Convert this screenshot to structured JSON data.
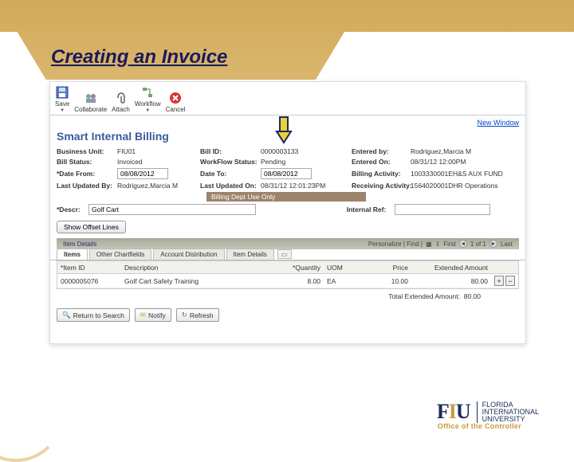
{
  "slide_title": "Creating an Invoice",
  "toolbar": {
    "save": "Save",
    "collaborate": "Collaborate",
    "attach": "Attach",
    "workflow": "Workflow",
    "cancel": "Cancel"
  },
  "links": {
    "new_window": "New Window"
  },
  "page_heading": "Smart Internal Billing",
  "form": {
    "business_unit": {
      "label": "Business Unit:",
      "value": "FIU01"
    },
    "bill_id": {
      "label": "Bill ID:",
      "value": "0000003133"
    },
    "entered_by": {
      "label": "Entered by:",
      "value": "Rodriguez,Marcia M"
    },
    "bill_status": {
      "label": "Bill Status:",
      "value": "Invoiced"
    },
    "workflow_status": {
      "label": "WorkFlow Status:",
      "value": "Pending"
    },
    "entered_on": {
      "label": "Entered On:",
      "value": "08/31/12 12:00PM"
    },
    "date_from": {
      "label": "*Date From:",
      "value": "08/08/2012"
    },
    "date_to": {
      "label": "Date To:",
      "value": "08/08/2012"
    },
    "billing_activity": {
      "label": "Billing Activity:",
      "value": "1003330001EH&S AUX FUND"
    },
    "last_updated_by": {
      "label": "Last Updated By:",
      "value": "Rodriguez,Marcia M"
    },
    "last_updated_on": {
      "label": "Last Updated On:",
      "value": "08/31/12 12:01:23PM"
    },
    "receiving_activity": {
      "label": "Receiving Activity:",
      "value": "1564020001DHR Operations"
    },
    "descr": {
      "label": "*Descr:",
      "value": "Golf Cart"
    },
    "internal_ref": {
      "label": "Internal Ref:",
      "value": ""
    }
  },
  "billing_dept_bar": "Billing Dept Use Only",
  "show_offset": "Show Offset Lines",
  "item_details_title": "Item Details",
  "tabs": {
    "items": "Items",
    "other": "Other Chartfields",
    "account": "Account Distribution",
    "details": "Item Details"
  },
  "grid_toolbar": {
    "personalize": "Personalize | Find |",
    "pager": "First",
    "count": "1 of 1",
    "last": "Last"
  },
  "grid": {
    "headers": {
      "item_id": "*Item ID",
      "description": "Description",
      "quantity": "*Quantity",
      "uom": "UOM",
      "price": "Price",
      "extended": "Extended Amount"
    },
    "rows": [
      {
        "item_id": "0000005076",
        "description": "Golf Cart Safety Training",
        "quantity": "8.00",
        "uom": "EA",
        "price": "10.00",
        "extended": "80.00"
      }
    ]
  },
  "total": {
    "label": "Total Extended Amount:",
    "value": "80.00"
  },
  "footer": {
    "return": "Return to Search",
    "notify": "Notify",
    "refresh": "Refresh"
  },
  "logo": {
    "uni1": "FLORIDA",
    "uni2": "INTERNATIONAL",
    "uni3": "UNIVERSITY",
    "office": "Office of the Controller"
  }
}
